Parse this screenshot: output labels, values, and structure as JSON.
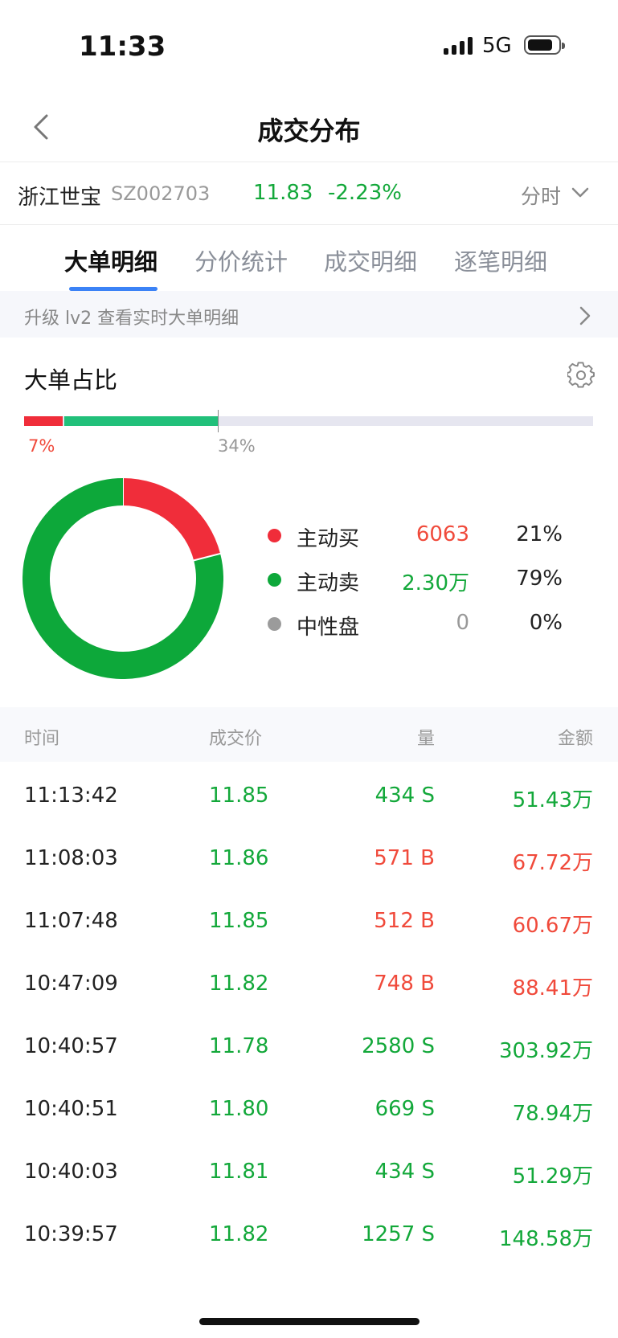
{
  "status_bar": {
    "time": "11:33",
    "network": "5G"
  },
  "nav": {
    "title": "成交分布"
  },
  "stock": {
    "name": "浙江世宝",
    "code": "SZ002703",
    "price": "11.83",
    "change": "-2.23%",
    "period": "分时"
  },
  "tabs": [
    {
      "label": "大单明细",
      "active": true
    },
    {
      "label": "分价统计",
      "active": false
    },
    {
      "label": "成交明细",
      "active": false
    },
    {
      "label": "逐笔明细",
      "active": false
    }
  ],
  "banner": {
    "text": "升级 lv2 查看实时大单明细"
  },
  "ratio": {
    "title": "大单占比",
    "red_label": "7%",
    "marker_label": "34%",
    "red_pct": 7,
    "green_pct": 34
  },
  "chart_data": {
    "type": "pie",
    "categories": [
      "主动买",
      "主动卖",
      "中性盘"
    ],
    "values": [
      6063,
      23000,
      0
    ],
    "value_labels": [
      "6063",
      "2.30万",
      "0"
    ],
    "percent_labels": [
      "21%",
      "79%",
      "0%"
    ],
    "percents": [
      21,
      79,
      0
    ],
    "colors": [
      "#f02d3a",
      "#0da83a",
      "#9b9b9b"
    ]
  },
  "table": {
    "headers": {
      "time": "时间",
      "price": "成交价",
      "volume": "量",
      "amount": "金额"
    },
    "rows": [
      {
        "time": "11:13:42",
        "price": "11.85",
        "volume": "434 S",
        "amount": "51.43万",
        "side": "S"
      },
      {
        "time": "11:08:03",
        "price": "11.86",
        "volume": "571 B",
        "amount": "67.72万",
        "side": "B"
      },
      {
        "time": "11:07:48",
        "price": "11.85",
        "volume": "512 B",
        "amount": "60.67万",
        "side": "B"
      },
      {
        "time": "10:47:09",
        "price": "11.82",
        "volume": "748 B",
        "amount": "88.41万",
        "side": "B"
      },
      {
        "time": "10:40:57",
        "price": "11.78",
        "volume": "2580 S",
        "amount": "303.92万",
        "side": "S"
      },
      {
        "time": "10:40:51",
        "price": "11.80",
        "volume": "669 S",
        "amount": "78.94万",
        "side": "S"
      },
      {
        "time": "10:40:03",
        "price": "11.81",
        "volume": "434 S",
        "amount": "51.29万",
        "side": "S"
      },
      {
        "time": "10:39:57",
        "price": "11.82",
        "volume": "1257 S",
        "amount": "148.58万",
        "side": "S"
      }
    ]
  },
  "icons": {
    "back": "chevron-left-icon",
    "period": "chevron-down-icon",
    "banner": "chevron-right-icon",
    "settings": "gear-icon"
  }
}
